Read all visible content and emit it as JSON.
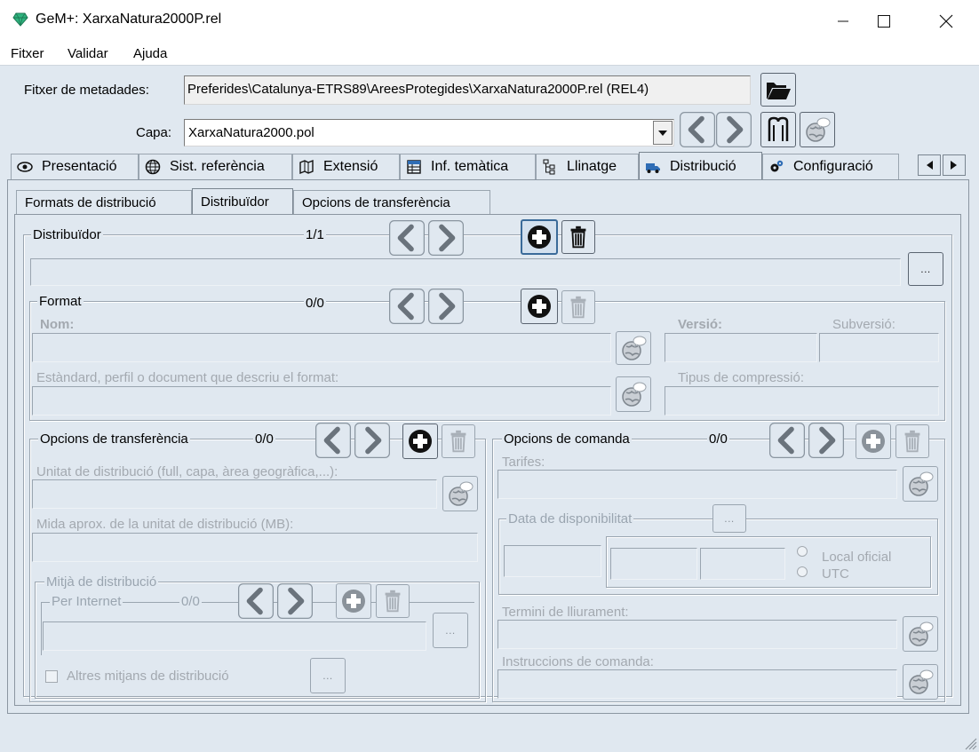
{
  "window": {
    "title": "GeM+: XarxaNatura2000P.rel",
    "controls": [
      "minimize",
      "maximize",
      "close"
    ]
  },
  "menu": [
    "Fitxer",
    "Validar",
    "Ajuda"
  ],
  "metadata_file": {
    "label": "Fitxer de metadades:",
    "value": "Preferides\\Catalunya-ETRS89\\AreesProtegides\\XarxaNatura2000P.rel (REL4)"
  },
  "layer": {
    "label": "Capa:",
    "value": "XarxaNatura2000.pol"
  },
  "tabs": [
    {
      "label": "Presentació",
      "icon": "eye-icon"
    },
    {
      "label": "Sist. referència",
      "icon": "globe-icon"
    },
    {
      "label": "Extensió",
      "icon": "map-icon"
    },
    {
      "label": "Inf. temàtica",
      "icon": "table-icon"
    },
    {
      "label": "Llinatge",
      "icon": "tree-icon"
    },
    {
      "label": "Distribució",
      "icon": "truck-icon",
      "active": true
    },
    {
      "label": "Configuració",
      "icon": "gears-icon"
    }
  ],
  "subtabs": [
    {
      "label": "Formats de distribució"
    },
    {
      "label": "Distribuïdor",
      "active": true
    },
    {
      "label": "Opcions de transferència"
    }
  ],
  "distributor": {
    "title": "Distribuïdor",
    "counter": "1/1",
    "value": "",
    "format": {
      "title": "Format",
      "counter": "0/0",
      "name_label": "Nom:",
      "version_label": "Versió:",
      "subversion_label": "Subversió:",
      "standard_label": "Estàndard, perfil o document que descriu el format:",
      "compression_label": "Tipus de compressió:"
    }
  },
  "transfer_options": {
    "title": "Opcions de transferència",
    "counter": "0/0",
    "unit_label": "Unitat de distribució (full, capa, àrea geogràfica,...):",
    "size_label": "Mida aprox. de la unitat de distribució (MB):",
    "medium": {
      "title": "Mitjà de distribució",
      "internet_title": "Per Internet",
      "internet_counter": "0/0",
      "other_label": "Altres mitjans de distribució",
      "other_checked": false
    }
  },
  "order_options": {
    "title": "Opcions de comanda",
    "counter": "0/0",
    "fees_label": "Tarifes:",
    "availability_title": "Data de disponibilitat",
    "radio_local": "Local oficial",
    "radio_utc": "UTC",
    "turnaround_label": "Termini de lliurament:",
    "instructions_label": "Instruccions de comanda:"
  },
  "ellipsis": "...",
  "colors": {
    "background": "#e0e8f0",
    "titlebar": "#ffffff",
    "border": "#9aa5b0",
    "disabled_text": "#a3a9b0"
  }
}
